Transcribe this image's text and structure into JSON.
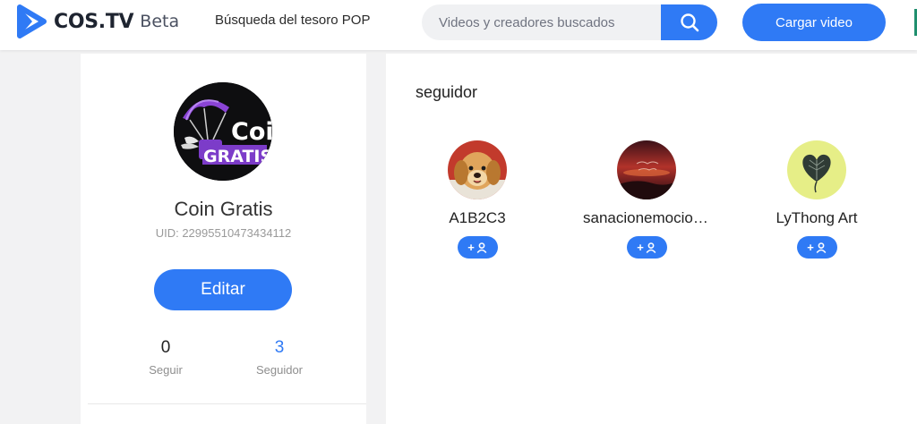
{
  "header": {
    "logo_text": "COS.TV",
    "logo_badge": "Beta",
    "nav_link": "Búsqueda del tesoro POP",
    "search": {
      "placeholder": "Videos y creadores buscados",
      "value": "",
      "icon": "search-icon"
    },
    "upload_label": "Cargar video",
    "colors": {
      "accent": "#2f7af5",
      "logo_play": "#2f7af5"
    }
  },
  "profile": {
    "avatar_text_line1": "Coin",
    "avatar_text_line2": "GRATIS",
    "name": "Coin Gratis",
    "uid": "UID: 22995510473434112",
    "edit_label": "Editar",
    "stats": [
      {
        "value": "0",
        "label": "Seguir"
      },
      {
        "value": "3",
        "label": "Seguidor"
      }
    ]
  },
  "followers_section": {
    "title": "seguidor",
    "followers": [
      {
        "name": "A1B2C3",
        "avatar": "puppy-avatar",
        "follow_icon": "add-user-icon",
        "follow_plus": "+"
      },
      {
        "name": "sanacionemocional",
        "avatar": "sunset-avatar",
        "follow_icon": "add-user-icon",
        "follow_plus": "+"
      },
      {
        "name": "LyThong Art",
        "avatar": "heart-leaf-avatar",
        "follow_icon": "add-user-icon",
        "follow_plus": "+"
      }
    ]
  }
}
